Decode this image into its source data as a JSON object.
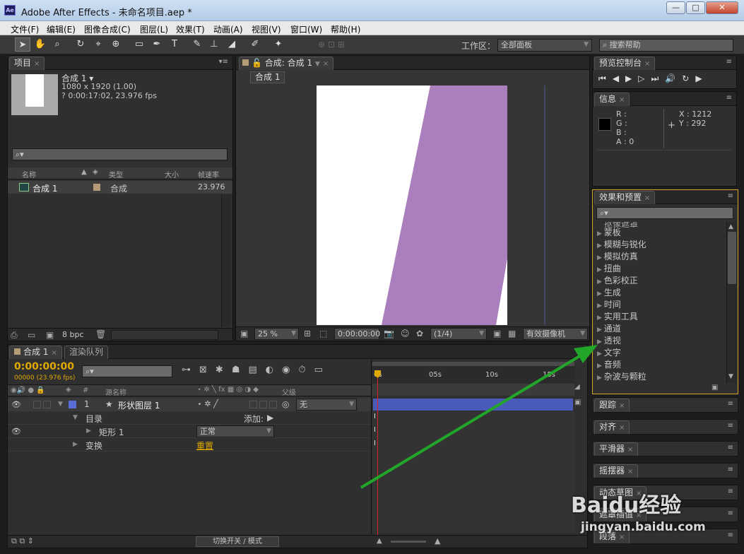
{
  "window": {
    "title": "Adobe After Effects - 未命名项目.aep *",
    "app_icon": "Ae",
    "btn_min": "—",
    "btn_max": "□",
    "btn_close": "✕"
  },
  "menu": [
    "文件(F)",
    "编辑(E)",
    "图像合成(C)",
    "图层(L)",
    "效果(T)",
    "动画(A)",
    "视图(V)",
    "窗口(W)",
    "帮助(H)"
  ],
  "toolbar": {
    "workspace_label": "工作区：",
    "workspace_value": "全部面板",
    "search_help": "搜索帮助"
  },
  "project": {
    "tab": "项目",
    "comp_name": "合成 1 ▾",
    "comp_dims": "1080 x 1920 (1.00)",
    "comp_duration": "? 0:00:17:02, 23.976 fps",
    "columns": {
      "name": "名称",
      "type": "类型",
      "size": "大小",
      "fps": "帧速率"
    },
    "items": [
      {
        "name": "合成 1",
        "type": "合成",
        "fps": "23.976"
      }
    ],
    "bpc": "8 bpc"
  },
  "composition": {
    "tab": "合成: 合成 1",
    "sub_tab": "合成 1",
    "zoom": "25 %",
    "timecode": "0:00:00:00",
    "resolution": "(1/4)",
    "camera": "有效摄像机",
    "shape_color": "#ab7fbd"
  },
  "preview": {
    "tab": "预览控制台"
  },
  "info": {
    "tab": "信息",
    "r": "R :",
    "g": "G :",
    "b": "B :",
    "a": "A : 0",
    "x": "X : 1212",
    "y": "Y : 292"
  },
  "effects": {
    "tab": "效果和预置",
    "partial_top": "抠像遮罩",
    "items": [
      "蒙板",
      "模糊与锐化",
      "模拟仿真",
      "扭曲",
      "色彩校正",
      "生成",
      "时间",
      "实用工具",
      "通道",
      "透视",
      "文字",
      "音频",
      "杂波与颗粒"
    ]
  },
  "side_panels": [
    "跟踪",
    "对齐",
    "平滑器",
    "摇摆器",
    "动态草图",
    "遮罩插值",
    "段落"
  ],
  "timeline": {
    "tab_comp": "合成 1",
    "tab_render": "渲染队列",
    "timecode": "0:00:00:00",
    "fps_text": "00000 (23.976 fps)",
    "col_source": "源名称",
    "col_parent": "父级",
    "col_num": "#",
    "ruler": [
      "0s",
      "05s",
      "10s",
      "15s"
    ],
    "layer": {
      "num": "1",
      "name": "形状图层 1",
      "parent": "无",
      "color": "#5a6fd6"
    },
    "contents": "目录",
    "add_label": "添加:",
    "rect": "矩形 1",
    "rect_mode": "正常",
    "transform": "变换",
    "reset": "重置",
    "switch_modes": "切换开关 / 模式"
  },
  "watermark": {
    "brand": "Baidu经验",
    "url": "jingyan.baidu.com"
  },
  "colors": {
    "accent_gold": "#e0a800",
    "layer_bar": "#4a5ab8",
    "arrow": "#22a62a"
  }
}
